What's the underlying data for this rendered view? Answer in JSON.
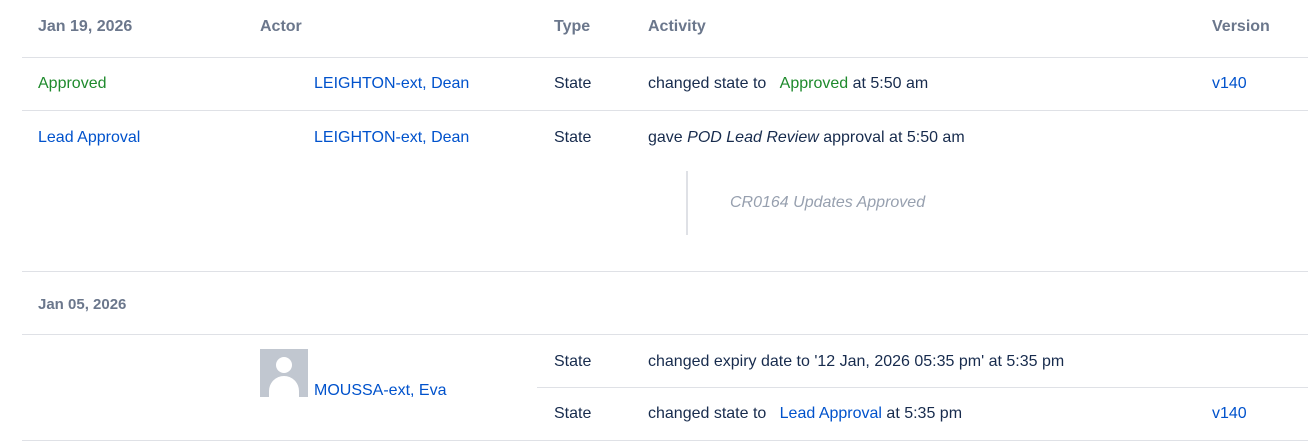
{
  "header": {
    "date": "Jan 19, 2026",
    "actor": "Actor",
    "type": "Type",
    "activity": "Activity",
    "version": "Version"
  },
  "rows": [
    {
      "event": "Approved",
      "actor": "LEIGHTON-ext, Dean",
      "type": "State",
      "activity_prefix": "changed state to",
      "activity_state": "Approved",
      "activity_suffix": "at 5:50 am",
      "version": "v140"
    },
    {
      "event": "Lead Approval",
      "actor": "LEIGHTON-ext, Dean",
      "type": "State",
      "activity_prefix": "gave",
      "activity_review": "POD Lead Review",
      "activity_suffix": "approval at 5:50 am",
      "comment": "CR0164 Updates Approved"
    }
  ],
  "group2": {
    "date": "Jan 05, 2026",
    "actor": "MOUSSA-ext, Eva",
    "rows": [
      {
        "type": "State",
        "activity": "changed expiry date to '12 Jan, 2026 05:35 pm' at 5:35 pm"
      },
      {
        "type": "State",
        "activity_prefix": "changed state to",
        "activity_state": "Lead Approval",
        "activity_suffix": "at 5:35 pm",
        "version": "v140"
      }
    ]
  }
}
